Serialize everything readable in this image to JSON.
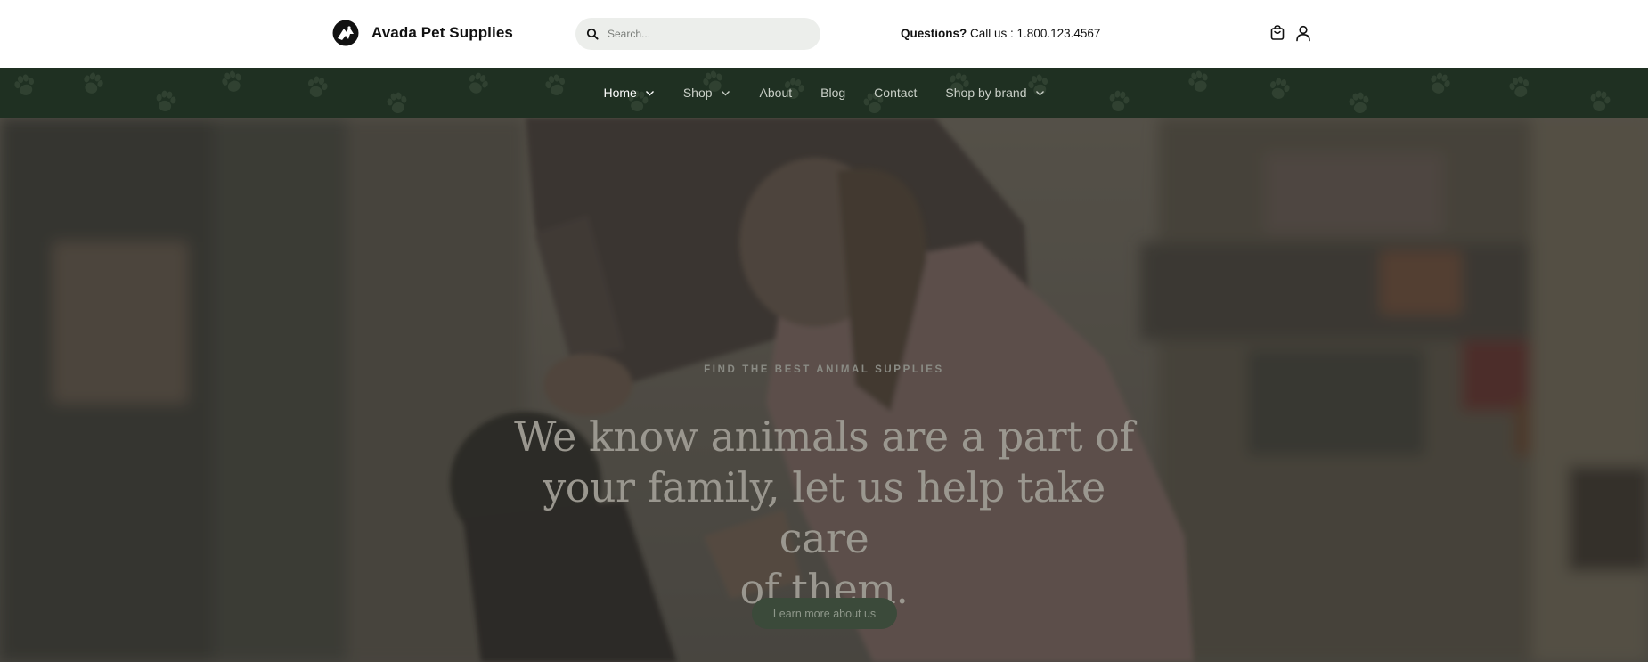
{
  "brand": {
    "name": "Avada Pet Supplies",
    "logo_icon": "bird-logo-icon"
  },
  "search": {
    "placeholder": "Search...",
    "value": ""
  },
  "contact": {
    "lead": "Questions?",
    "text": "Call us : 1.800.123.4567"
  },
  "header_icons": {
    "cart": "shopping-bag-icon",
    "account": "user-icon"
  },
  "nav": {
    "items": [
      {
        "label": "Home",
        "has_dropdown": true,
        "active": true
      },
      {
        "label": "Shop",
        "has_dropdown": true,
        "active": false
      },
      {
        "label": "About",
        "has_dropdown": false,
        "active": false
      },
      {
        "label": "Blog",
        "has_dropdown": false,
        "active": false
      },
      {
        "label": "Contact",
        "has_dropdown": false,
        "active": false
      },
      {
        "label": "Shop by brand",
        "has_dropdown": true,
        "active": false
      }
    ],
    "background_pattern": "paw-print-icon"
  },
  "hero": {
    "eyebrow": "FIND THE BEST ANIMAL SUPPLIES",
    "headline_line1": "We know animals are a part of",
    "headline_line2": "your family, let us help take care",
    "headline_line3": "of them.",
    "cta_label": "Learn more about us"
  },
  "colors": {
    "nav_bg": "#1f3022",
    "search_bg": "#eceeeb",
    "cta_bg": "#3b4a3a",
    "text_dark": "#111111"
  }
}
